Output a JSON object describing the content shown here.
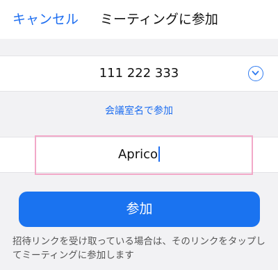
{
  "nav": {
    "cancel_label": "キャンセル",
    "title": "ミーティングに参加"
  },
  "meeting": {
    "id_value": "111 222 333",
    "dropdown_icon": "chevron-down-circle-icon"
  },
  "room_link_label": "会議室名で参加",
  "name_input": {
    "value": "Aprico"
  },
  "join_button_label": "参加",
  "hint_text": "招待リンクを受け取っている場合は、そのリンクをタップしてミーティングに参加します",
  "colors": {
    "accent": "#1a73f0",
    "link": "#1e6ef0",
    "highlight": "#f2a8c8",
    "background": "#f2f2f4"
  }
}
